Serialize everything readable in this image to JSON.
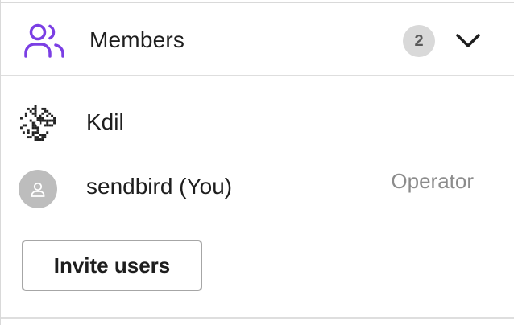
{
  "header": {
    "icon": "members-icon",
    "title": "Members",
    "count": "2",
    "toggle_icon": "chevron-down-icon",
    "accent_color": "#7b3fe4"
  },
  "members": [
    {
      "name": "Kdil",
      "avatar": "qr-pattern-avatar",
      "role": ""
    },
    {
      "name": "sendbird (You)",
      "avatar": "default-user-avatar",
      "role": "Operator"
    }
  ],
  "actions": {
    "invite_label": "Invite users"
  }
}
